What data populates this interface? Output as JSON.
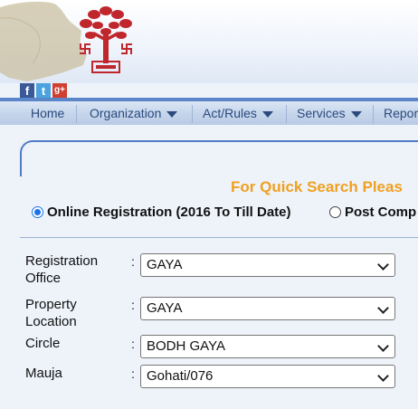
{
  "header": {
    "social": [
      "f",
      "t",
      "g+"
    ]
  },
  "nav": {
    "items": [
      {
        "label": "Home",
        "has_dropdown": false
      },
      {
        "label": "Organization",
        "has_dropdown": true
      },
      {
        "label": "Act/Rules",
        "has_dropdown": true
      },
      {
        "label": "Services",
        "has_dropdown": true
      },
      {
        "label": "Repor",
        "has_dropdown": false
      }
    ]
  },
  "search": {
    "quick_search_text": "For Quick Search Pleas",
    "options": [
      {
        "label": "Online Registration (2016 To Till Date)",
        "selected": true
      },
      {
        "label": "Post Comp",
        "selected": false
      }
    ]
  },
  "form": {
    "fields": [
      {
        "label_line1": "Registration",
        "label_line2": "Office",
        "value": "GAYA"
      },
      {
        "label_line1": "Property",
        "label_line2": "Location",
        "value": "GAYA"
      },
      {
        "label_line1": "Circle",
        "label_line2": "",
        "value": "BODH GAYA"
      },
      {
        "label_line1": "Mauja",
        "label_line2": "",
        "value": "Gohati/076"
      }
    ],
    "colon": ":"
  },
  "colors": {
    "accent": "#f0a020",
    "nav_text": "#2b4a7d",
    "nav_border": "#5b86c7"
  }
}
